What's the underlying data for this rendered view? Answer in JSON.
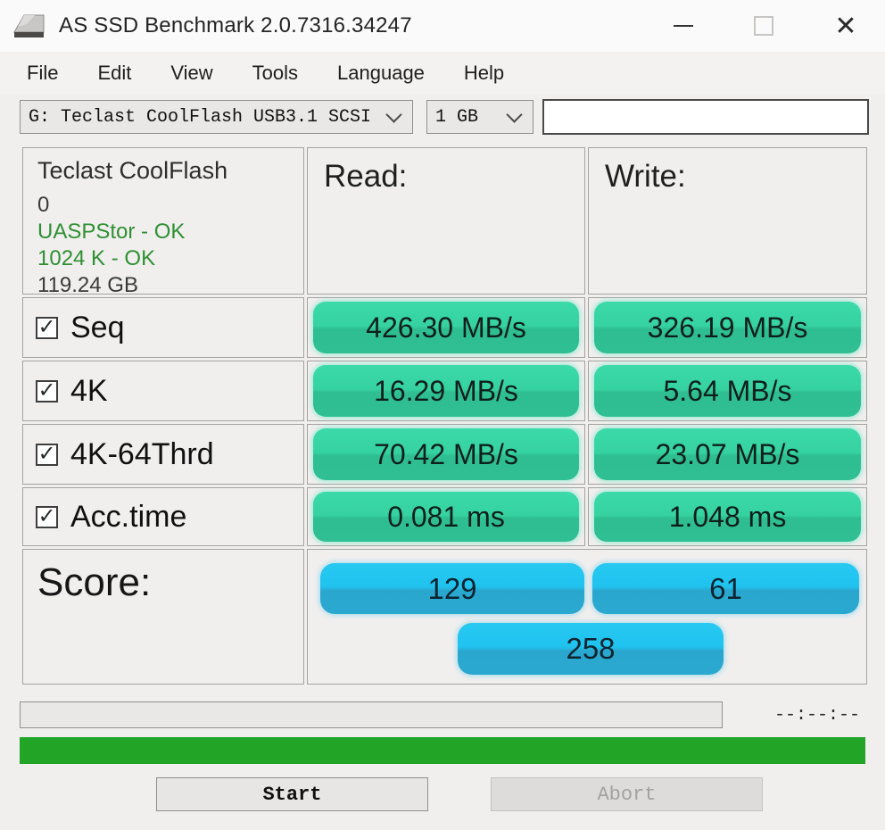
{
  "window": {
    "title": "AS SSD Benchmark 2.0.7316.34247",
    "close_label": "✕"
  },
  "menu": {
    "items": [
      "File",
      "Edit",
      "View",
      "Tools",
      "Language",
      "Help"
    ]
  },
  "toolbar": {
    "drive_value": "G: Teclast CoolFlash USB3.1 SCSI",
    "test_size_value": "1 GB",
    "text_field_value": ""
  },
  "info": {
    "device": "Teclast CoolFlash",
    "line2": "0",
    "driver_status": "UASPStor - OK",
    "alignment_status": "1024 K - OK",
    "capacity": "119.24 GB"
  },
  "headers": {
    "read": "Read:",
    "write": "Write:"
  },
  "rows": [
    {
      "label": "Seq",
      "checked": true,
      "read": "426.30 MB/s",
      "write": "326.19 MB/s"
    },
    {
      "label": "4K",
      "checked": true,
      "read": "16.29 MB/s",
      "write": "5.64 MB/s"
    },
    {
      "label": "4K-64Thrd",
      "checked": true,
      "read": "70.42 MB/s",
      "write": "23.07 MB/s"
    },
    {
      "label": "Acc.time",
      "checked": true,
      "read": "0.081 ms",
      "write": "1.048 ms"
    }
  ],
  "checkbox_glyph": "✓",
  "score": {
    "label": "Score:",
    "read": "129",
    "write": "61",
    "total": "258"
  },
  "status": {
    "time": "--:--:--"
  },
  "buttons": {
    "start": "Start",
    "abort": "Abort"
  },
  "colors": {
    "result_pill_top": "#3cdaa9",
    "result_pill_bottom": "#2ebe91",
    "score_pill_top": "#27c9f1",
    "score_pill_bottom": "#2aa7cf",
    "bottom_bar_green": "#22a427",
    "ok_text_green": "#2f8f33",
    "window_bg": "#f0efee"
  }
}
